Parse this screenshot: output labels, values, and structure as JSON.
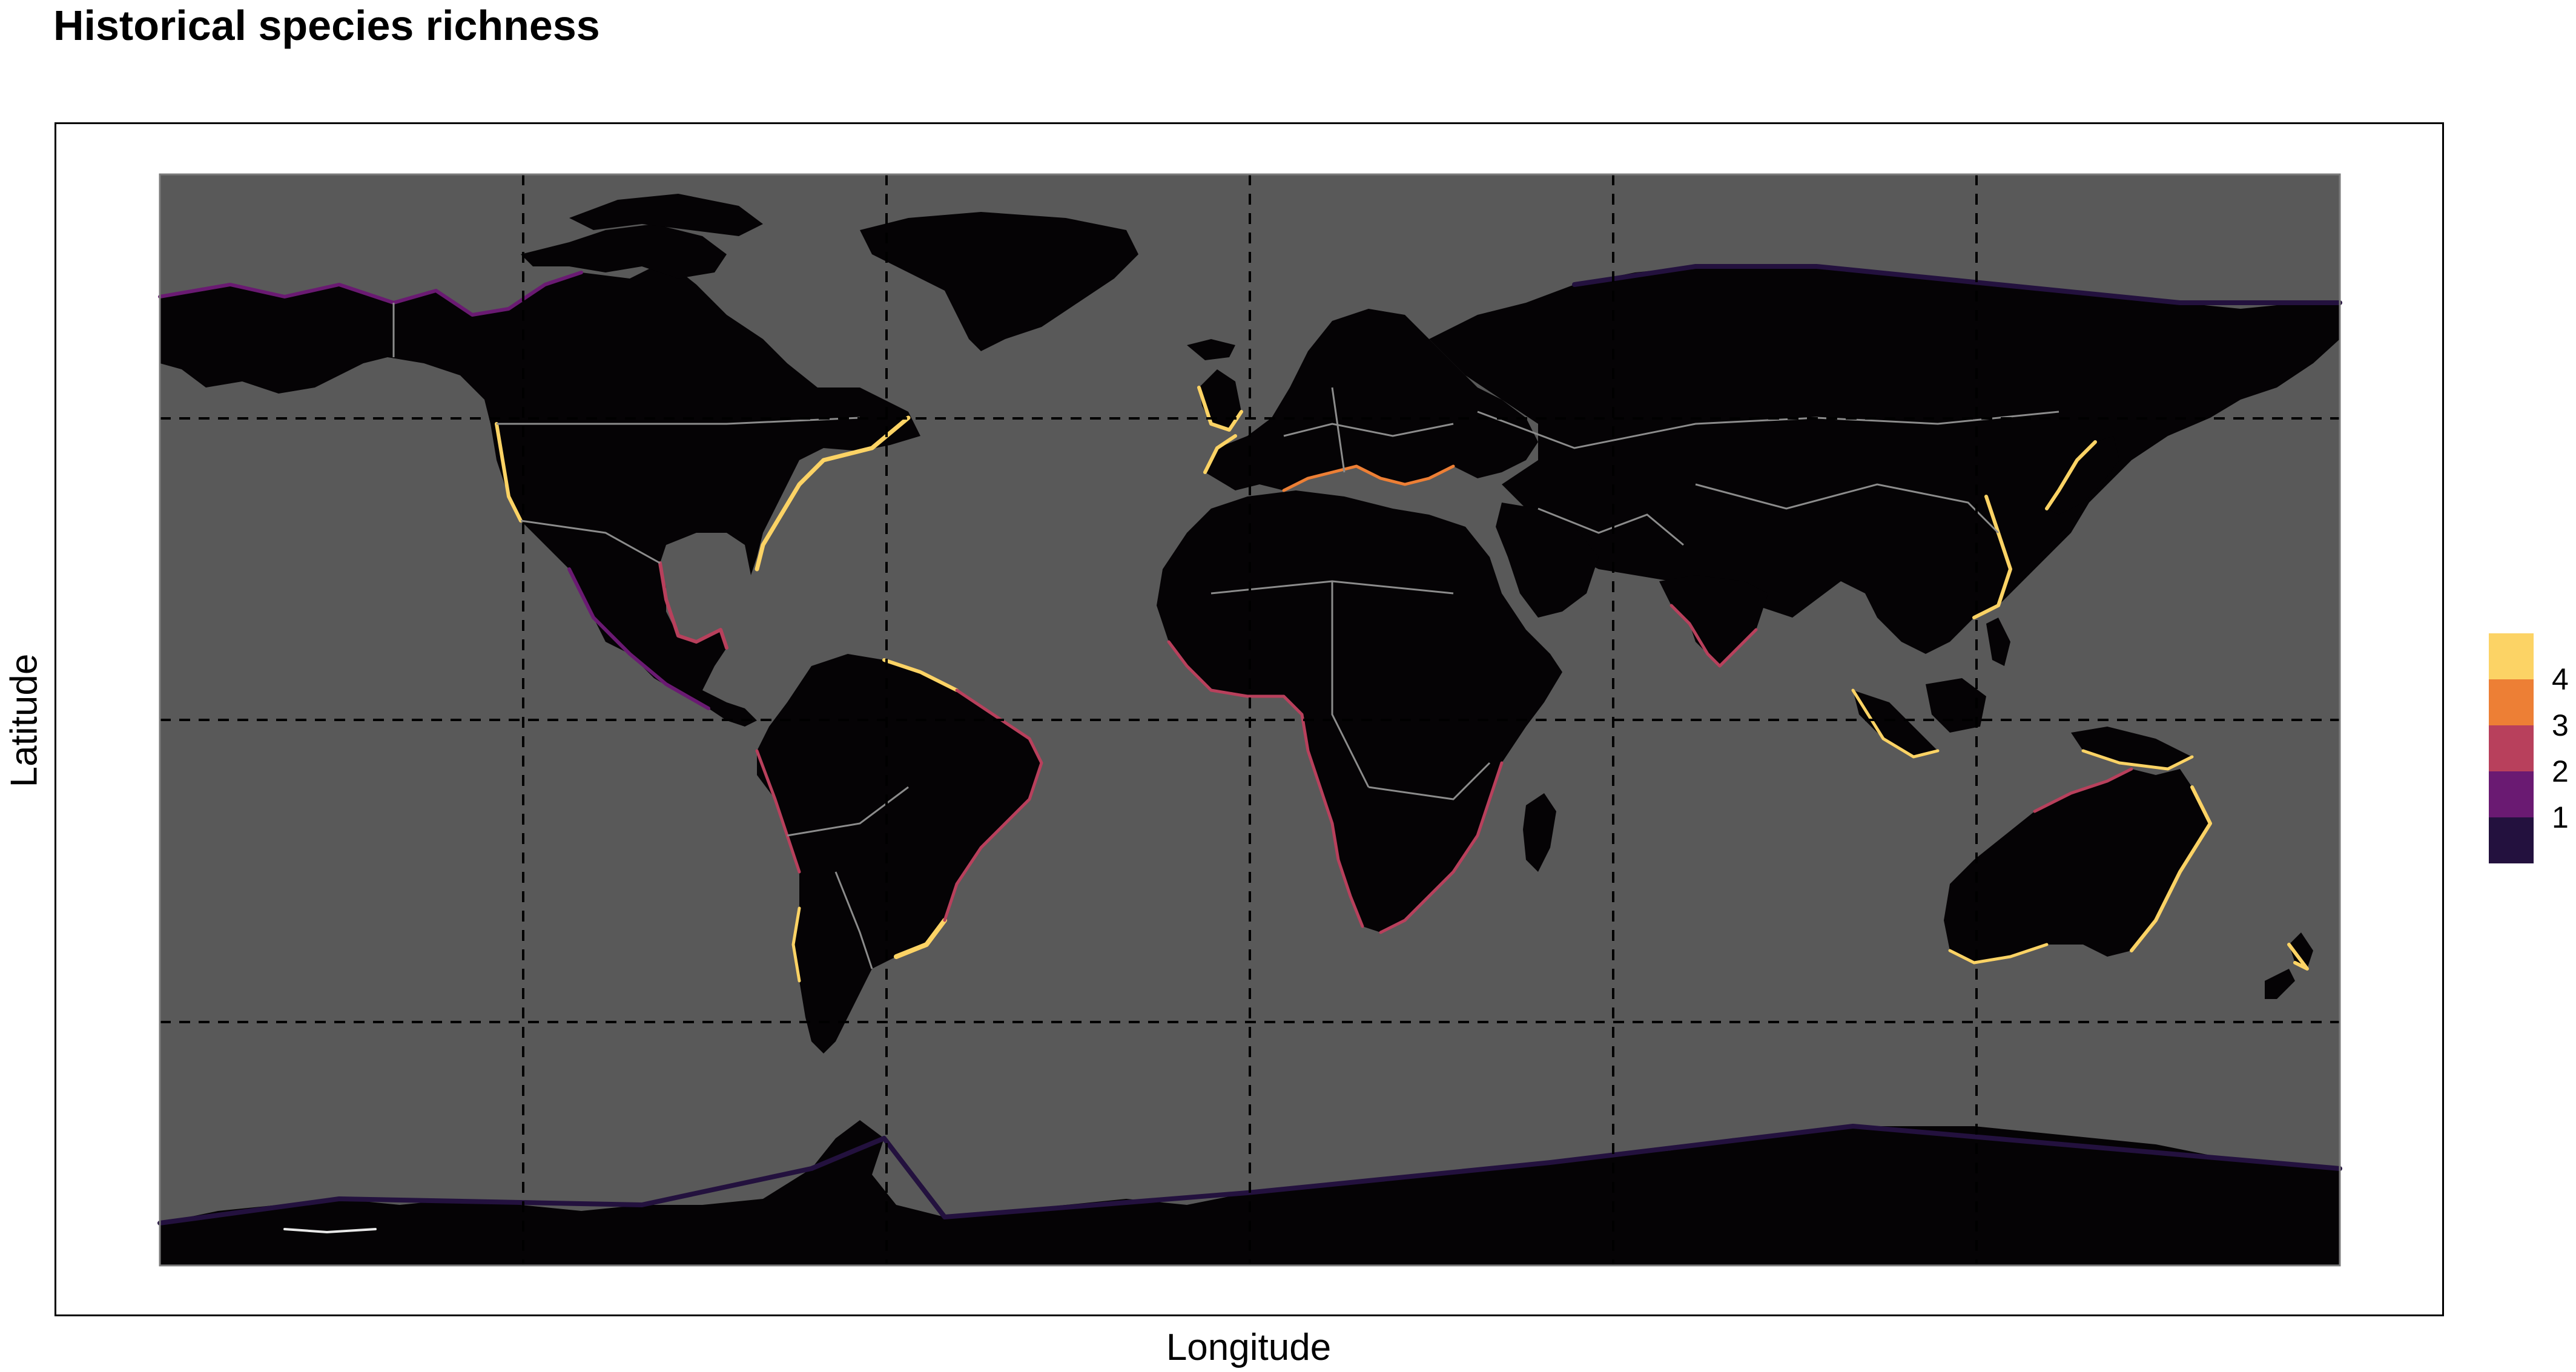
{
  "title": "Historical species richness",
  "axes": {
    "x_label": "Longitude",
    "y_label": "Latitude"
  },
  "map": {
    "ocean_color": "#595959",
    "land_color": "#050305",
    "border_color": "#8c8c8c",
    "gridline_style": "dashed",
    "gridline_color": "#000000"
  },
  "legend": {
    "title": "",
    "position": "right",
    "items": [
      {
        "value": "4",
        "color": "#FCD365"
      },
      {
        "value": "3",
        "color": "#ED7F35"
      },
      {
        "value": "2",
        "color": "#B8405C"
      },
      {
        "value": "1",
        "color": "#6A1A72"
      },
      {
        "value": "",
        "color": "#23113E"
      }
    ]
  }
}
